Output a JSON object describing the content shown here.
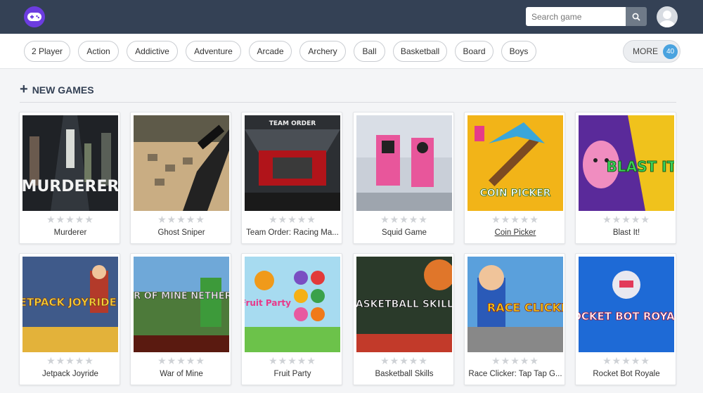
{
  "header": {
    "search_placeholder": "Search game",
    "icons": {
      "logo": "gamepad-icon",
      "search": "search-icon",
      "avatar": "user-avatar-icon"
    }
  },
  "categories": [
    {
      "label": "2 Player"
    },
    {
      "label": "Action"
    },
    {
      "label": "Addictive"
    },
    {
      "label": "Adventure"
    },
    {
      "label": "Arcade"
    },
    {
      "label": "Archery"
    },
    {
      "label": "Ball"
    },
    {
      "label": "Basketball"
    },
    {
      "label": "Board"
    },
    {
      "label": "Boys"
    }
  ],
  "more": {
    "label": "MORE",
    "count": "40"
  },
  "section": {
    "title": "NEW GAMES"
  },
  "games": [
    {
      "title": "Murderer",
      "thumb_text": "MURDERER"
    },
    {
      "title": "Ghost Sniper",
      "thumb_text": ""
    },
    {
      "title": "Team Order: Racing Ma...",
      "thumb_text": "TEAM ORDER"
    },
    {
      "title": "Squid Game",
      "thumb_text": ""
    },
    {
      "title": "Coin Picker",
      "thumb_text": "COIN PICKER"
    },
    {
      "title": "Blast It!",
      "thumb_text": "BLAST IT!"
    },
    {
      "title": "Jetpack Joyride",
      "thumb_text": "JETPACK JOYRIDE"
    },
    {
      "title": "War of Mine",
      "thumb_text": "WAR OF MINE NETHER"
    },
    {
      "title": "Fruit Party",
      "thumb_text": "Fruit Party"
    },
    {
      "title": "Basketball Skills",
      "thumb_text": "BASKETBALL SKILLS"
    },
    {
      "title": "Race Clicker: Tap Tap G...",
      "thumb_text": "RACE CLICKER"
    },
    {
      "title": "Rocket Bot Royale",
      "thumb_text": "ROCKET BOT ROYALE"
    }
  ],
  "rating_stars": "★★★★★",
  "colors": {
    "header": "#344155",
    "accent": "#6c3ce0",
    "badge": "#4aa3df"
  }
}
